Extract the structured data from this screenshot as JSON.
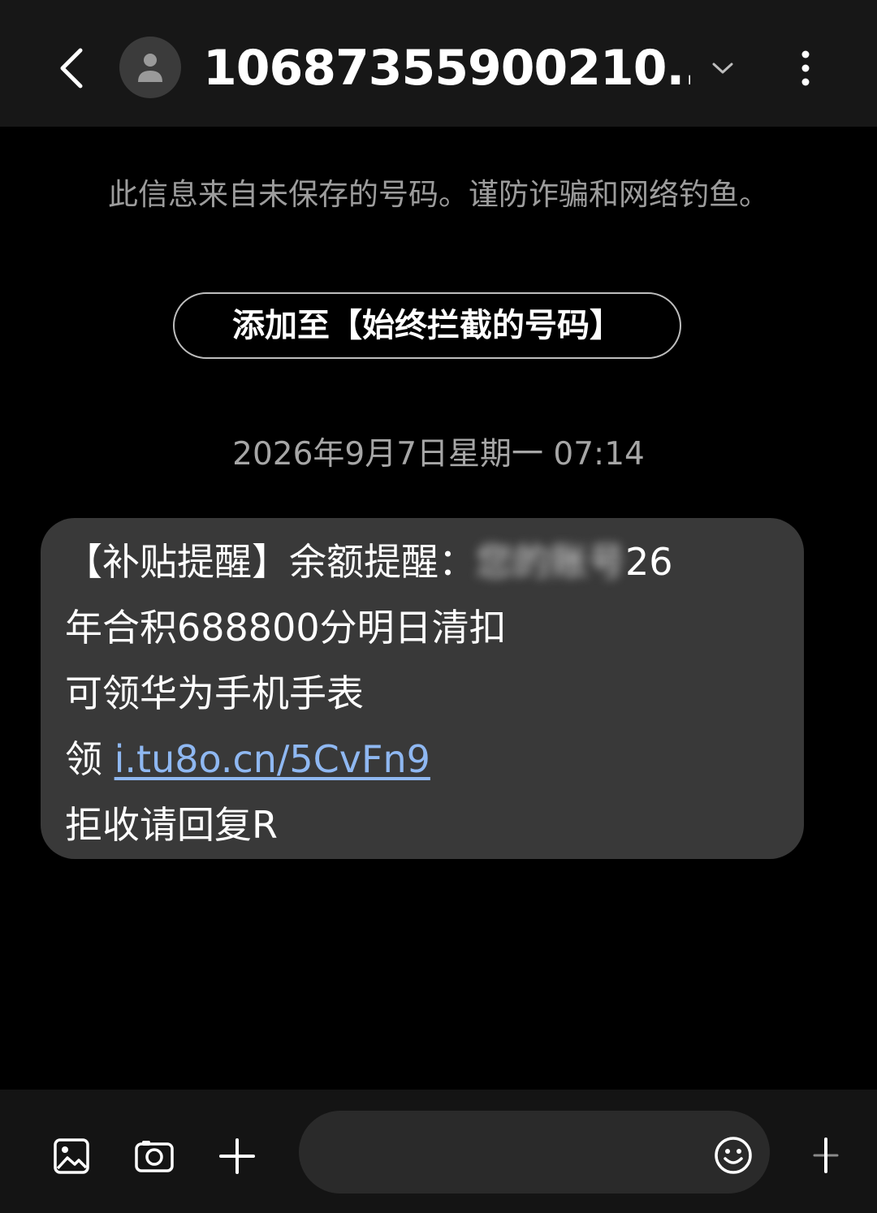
{
  "header": {
    "contact_name": "10687355900210...",
    "back_icon": "chevron-left-icon",
    "avatar_icon": "person-icon",
    "expand_icon": "chevron-down-icon",
    "menu_icon": "more-vertical-icon"
  },
  "notice": {
    "warning_text": "此信息来自未保存的号码。谨防诈骗和网络钓鱼。",
    "block_button_label": "添加至【始终拦截的号码】"
  },
  "conversation": {
    "date_separator": "2026年9月7日星期一 07:14",
    "message": {
      "line1_prefix": "【补贴提醒】余额提醒：",
      "line1_blurred": "您的账号",
      "line1_suffix": "26",
      "line2": "年合积688800分明日清扣",
      "line3": "可领华为手机手表",
      "line4_prefix": "领 ",
      "link": "i.tu8o.cn/5CvFn9",
      "line5": "拒收请回复R"
    }
  },
  "composer": {
    "gallery_icon": "image-icon",
    "camera_icon": "camera-icon",
    "add_icon": "plus-icon",
    "input_value": "",
    "input_placeholder": "",
    "emoji_icon": "smiley-icon",
    "send_icon": "send-icon"
  },
  "colors": {
    "background": "#000000",
    "header": "#171717",
    "bubble": "#393939",
    "link": "#8fb8f2",
    "muted_text": "#9c9c9c"
  }
}
